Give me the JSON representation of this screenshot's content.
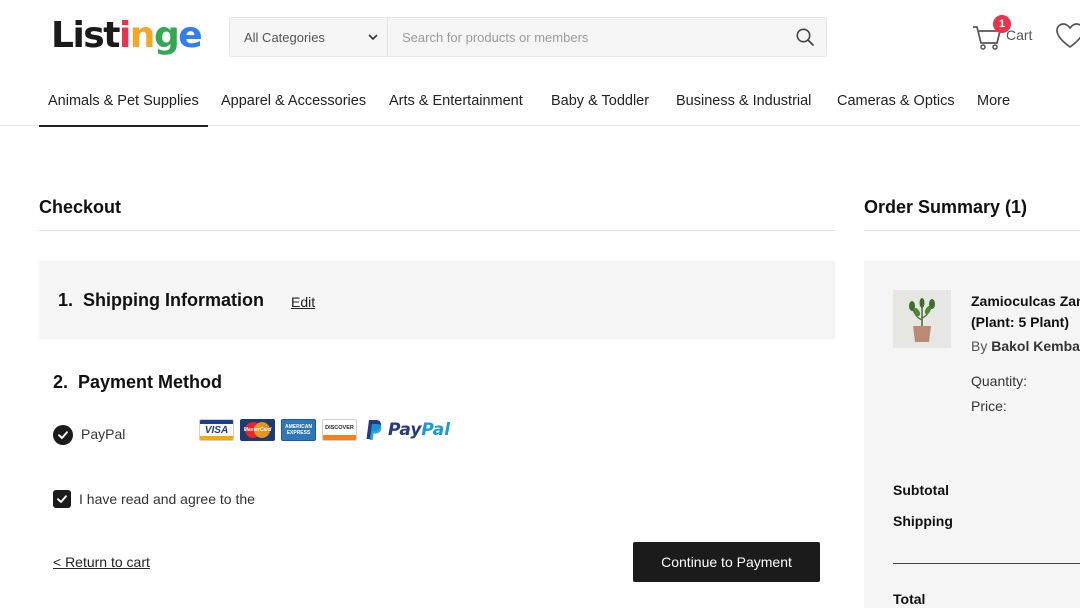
{
  "brand": {
    "letters": [
      {
        "ch": "L",
        "color": "#1a1a1a"
      },
      {
        "ch": "i",
        "color": "#1a1a1a"
      },
      {
        "ch": "s",
        "color": "#1a1a1a"
      },
      {
        "ch": "t",
        "color": "#1a1a1a"
      },
      {
        "ch": "i",
        "color": "#e8334a"
      },
      {
        "ch": "n",
        "color": "#f5a623"
      },
      {
        "ch": "g",
        "color": "#34a853"
      },
      {
        "ch": "e",
        "color": "#2f80ed"
      }
    ]
  },
  "header": {
    "category_select": "All Categories",
    "search_placeholder": "Search for products or members",
    "cart_label": "Cart",
    "cart_count": "1",
    "accent_color": "#e8334a"
  },
  "nav": {
    "items": [
      {
        "label": "Animals & Pet Supplies",
        "active": true
      },
      {
        "label": "Apparel & Accessories"
      },
      {
        "label": "Arts & Entertainment"
      },
      {
        "label": "Baby & Toddler"
      },
      {
        "label": "Business & Industrial"
      },
      {
        "label": "Cameras & Optics"
      },
      {
        "label": "More"
      }
    ]
  },
  "checkout": {
    "title": "Checkout",
    "shipping": {
      "title": "1.  Shipping Information",
      "edit_label": "Edit"
    },
    "payment": {
      "title": "2.  Payment Method",
      "selected_method": "PayPal",
      "card_icons": [
        "visa-icon",
        "mastercard-icon",
        "amex-icon",
        "discover-icon",
        "paypal-icon"
      ],
      "paypal_brand_text": "PayPal",
      "card_texts": {
        "visa": "VISA",
        "mastercard": "MasterCard",
        "amex": "AMERICAN EXPRESS",
        "discover": "DISCOVER"
      }
    },
    "agree_text": "I have read and agree to the",
    "return_link": "< Return to cart",
    "continue_button": "Continue to Payment"
  },
  "summary": {
    "title": "Order Summary (1)",
    "product": {
      "name_line1": "Zamioculcas Zam",
      "name_line2": "(Plant: 5 Plant)",
      "by_prefix": "By",
      "seller": "Bakol Kembar"
    },
    "quantity_label": "Quantity:",
    "price_label": "Price:",
    "subtotal_label": "Subtotal",
    "shipping_label": "Shipping",
    "total_label": "Total"
  }
}
